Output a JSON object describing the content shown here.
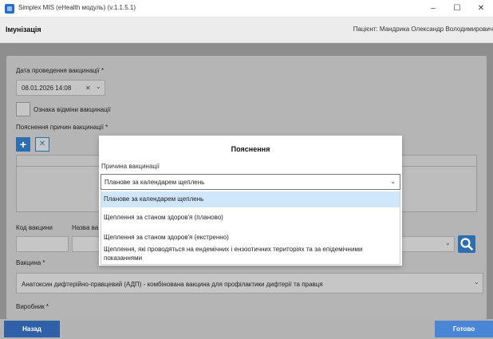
{
  "window": {
    "title": "Simplex MIS (eHealth модуль) (v.1.1.5.1)",
    "minimize": "–",
    "maximize": "☐",
    "close": "✕"
  },
  "header": {
    "page_title": "Імунізація",
    "patient": "Пацієнт: Мандрика Олександр Володимирович"
  },
  "form": {
    "date_label": "Дата проведення вакцинації *",
    "date_value": "08.01.2026 14:08",
    "date_clear": "✕",
    "date_chevron": "⌄",
    "cancel_flag_label": "Ознака відміни вакцинації",
    "reasons_label": "Пояснення причин вакцинації *",
    "add_symbol": "+",
    "remove_symbol": "✕",
    "vaccine_code_label": "Код вакцини",
    "vaccine_name_label": "Назва ва",
    "search_chevron": "⌄",
    "vaccine_label": "Вакцина *",
    "vaccine_value": "Анатоксин дифтерійно-правцевий (АДП) - комбінована вакцина для профілактики дифтерії та правця",
    "vaccine_chevron": "⌄",
    "manufacturer_label": "Виробник *"
  },
  "bottom": {
    "back": "Назад",
    "done": "Готово"
  },
  "modal": {
    "title": "Пояснення",
    "reason_label": "Причина вакцинації",
    "selected_value": "Планове за календарем щеплень",
    "chevron": "⌄",
    "options": [
      "Планове за календарем щеплень",
      "Щеплення за станом здоров'я (планово)",
      "Щеплення за станом здоров'я (екстренно)",
      "Щеплення, які проводяться на ендемічних і ензоотичних територіях та за епідемічними показаннями"
    ]
  },
  "colors": {
    "accent_blue": "#2b6fb0",
    "back_button": "#2e61a8",
    "done_button": "#4a86d6",
    "selected_option": "#cfe6fb"
  }
}
